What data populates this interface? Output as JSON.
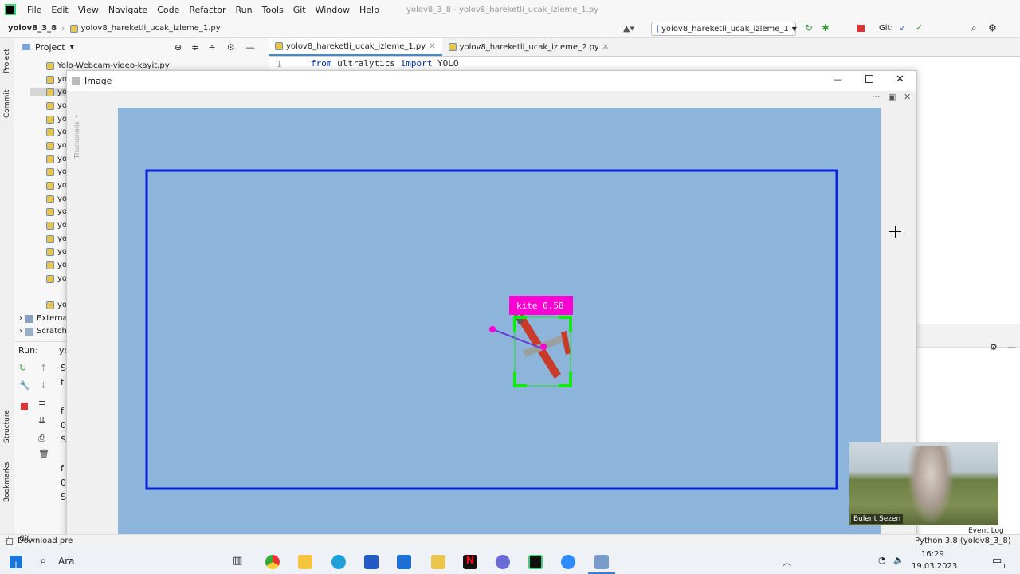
{
  "menu": [
    "File",
    "Edit",
    "View",
    "Navigate",
    "Code",
    "Refactor",
    "Run",
    "Tools",
    "Git",
    "Window",
    "Help"
  ],
  "window_title": "yolov8_3_8 - yolov8_hareketli_ucak_izleme_1.py",
  "nav": {
    "project": "yolov8_3_8",
    "file": "yolov8_hareketli_ucak_izleme_1.py",
    "run_config": "yolov8_hareketli_ucak_izleme_1",
    "git_label": "Git:"
  },
  "project_panel": {
    "title": "Project",
    "items": [
      "Yolo-Webcam-video-kayit.py",
      "yol",
      "yolo",
      "yol",
      "yol",
      "yol",
      "yol",
      "yol",
      "yol",
      "yol",
      "yol",
      "yol",
      "yol",
      "yol",
      "yol",
      "yol",
      "yol",
      "yol"
    ],
    "external": "Externa",
    "scratches": "Scratch"
  },
  "tabs": [
    "yolov8_hareketli_ucak_izleme_1.py",
    "yolov8_hareketli_ucak_izleme_2.py"
  ],
  "editor": {
    "line_no": "1",
    "code_keyword1": "from",
    "code_module": "ultralytics",
    "code_keyword2": "import",
    "code_name": "YOLO"
  },
  "inspections": {
    "warnings": "1",
    "weak": "7",
    "ok": "14"
  },
  "run_panel": {
    "label": "Run:",
    "tab": "yo",
    "lines": [
      "S",
      "f",
      "f",
      "0",
      "S",
      "f",
      "0",
      "S"
    ]
  },
  "image_window": {
    "title": "Image",
    "sidebar_label": "Thumbnails"
  },
  "detection": {
    "label": "kite 0.58",
    "class": "kite",
    "confidence": 0.58
  },
  "left_strip": {
    "project": "Project",
    "commit": "Commit",
    "structure": "Structure",
    "bookmarks": "Bookmarks"
  },
  "status": {
    "left": "Download pre",
    "right": "Python 3.8 (yolov8_3_8)",
    "git": "Git",
    "event_log": "Event Log"
  },
  "webcam": {
    "name": "Bulent Sezen"
  },
  "taskbar": {
    "search": "Ara",
    "time": "16:29",
    "date": "19.03.2023",
    "notifications": "1"
  },
  "colors": {
    "accent": "#4a86c8",
    "canvas": "#8db4db",
    "roi": "#0a22d8",
    "label_bg": "#ff00d4",
    "box": "#19e619"
  }
}
